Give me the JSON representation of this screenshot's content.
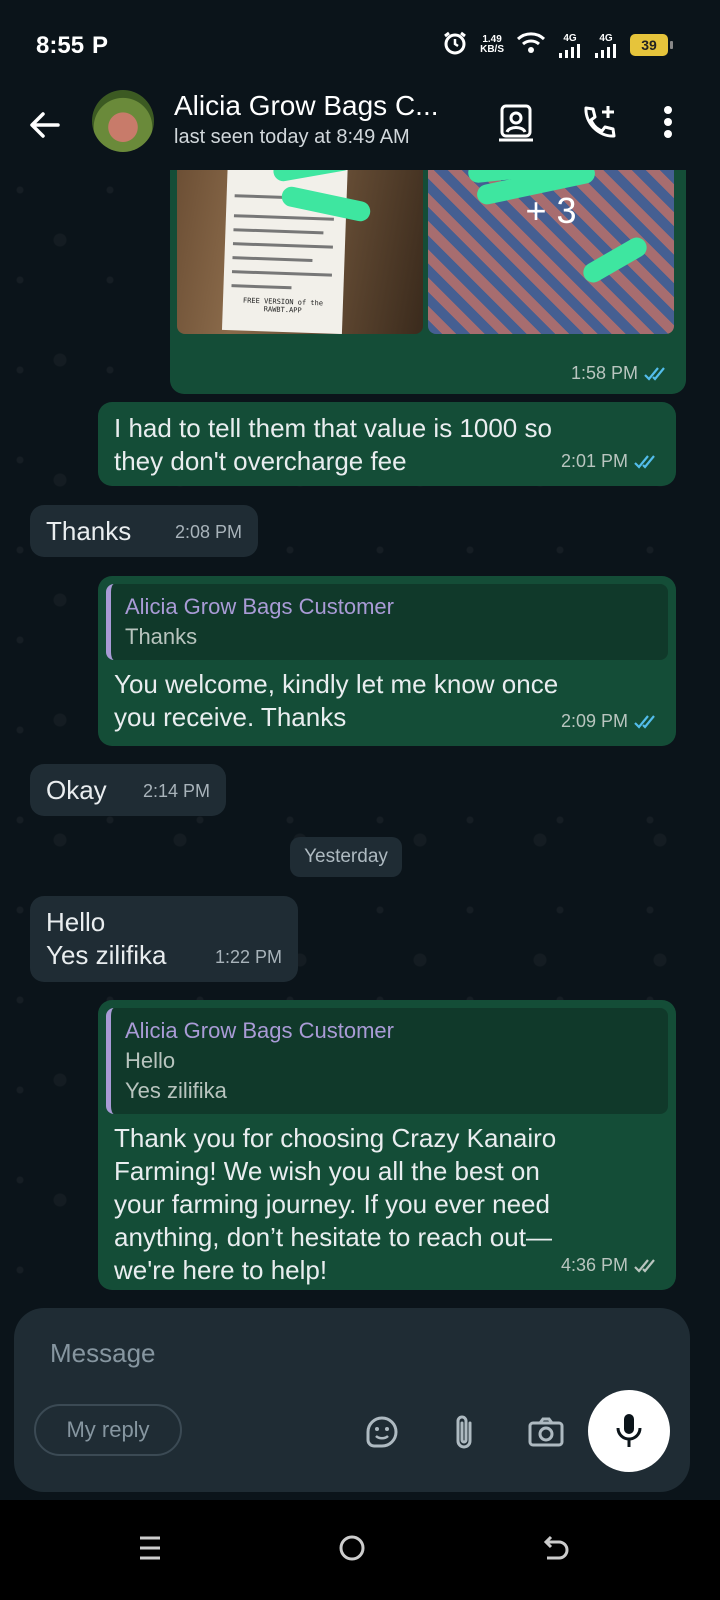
{
  "status_bar": {
    "time": "8:55",
    "net_speed_value": "1.49",
    "net_speed_unit": "KB/S",
    "signal_1": "4G",
    "signal_2": "4G",
    "battery": "39"
  },
  "header": {
    "contact_name": "Alicia Grow Bags C...",
    "last_seen": "last seen today at 8:49 AM"
  },
  "messages": [
    {
      "type": "photos",
      "extra_count": "+ 3",
      "time": "1:58 PM",
      "receipt_footer": "FREE VERSION of the RAWBT.APP"
    },
    {
      "type": "outgoing",
      "text": "I had to tell them that value is 1000 so\nthey don't overcharge fee",
      "time": "2:01 PM"
    },
    {
      "type": "incoming",
      "text": "Thanks",
      "time": "2:08 PM"
    },
    {
      "type": "outgoing",
      "quote_name": "Alicia Grow Bags Customer",
      "quote_text": "Thanks",
      "text": "You welcome, kindly let me know once\nyou receive. Thanks",
      "time": "2:09 PM"
    },
    {
      "type": "incoming",
      "text": "Okay",
      "time": "2:14 PM"
    },
    {
      "type": "incoming",
      "text": "Hello\nYes zilifika",
      "time": "1:22 PM"
    },
    {
      "type": "outgoing",
      "quote_name": "Alicia Grow Bags Customer",
      "quote_text": "Hello\nYes zilifika",
      "text": "Thank you for choosing Crazy Kanairo\nFarming! We wish you all the best on\nyour farming journey. If you ever need\nanything, don’t hesitate to reach out—\nwe're here to help!",
      "time": "4:36 PM"
    }
  ],
  "date_chip": "Yesterday",
  "composer": {
    "placeholder": "Message",
    "my_reply_label": "My reply"
  },
  "colors": {
    "outgoing_bubble": "#144d37",
    "incoming_bubble": "#1f2c34",
    "read_ticks": "#53bdeb",
    "background": "#0b141a"
  }
}
